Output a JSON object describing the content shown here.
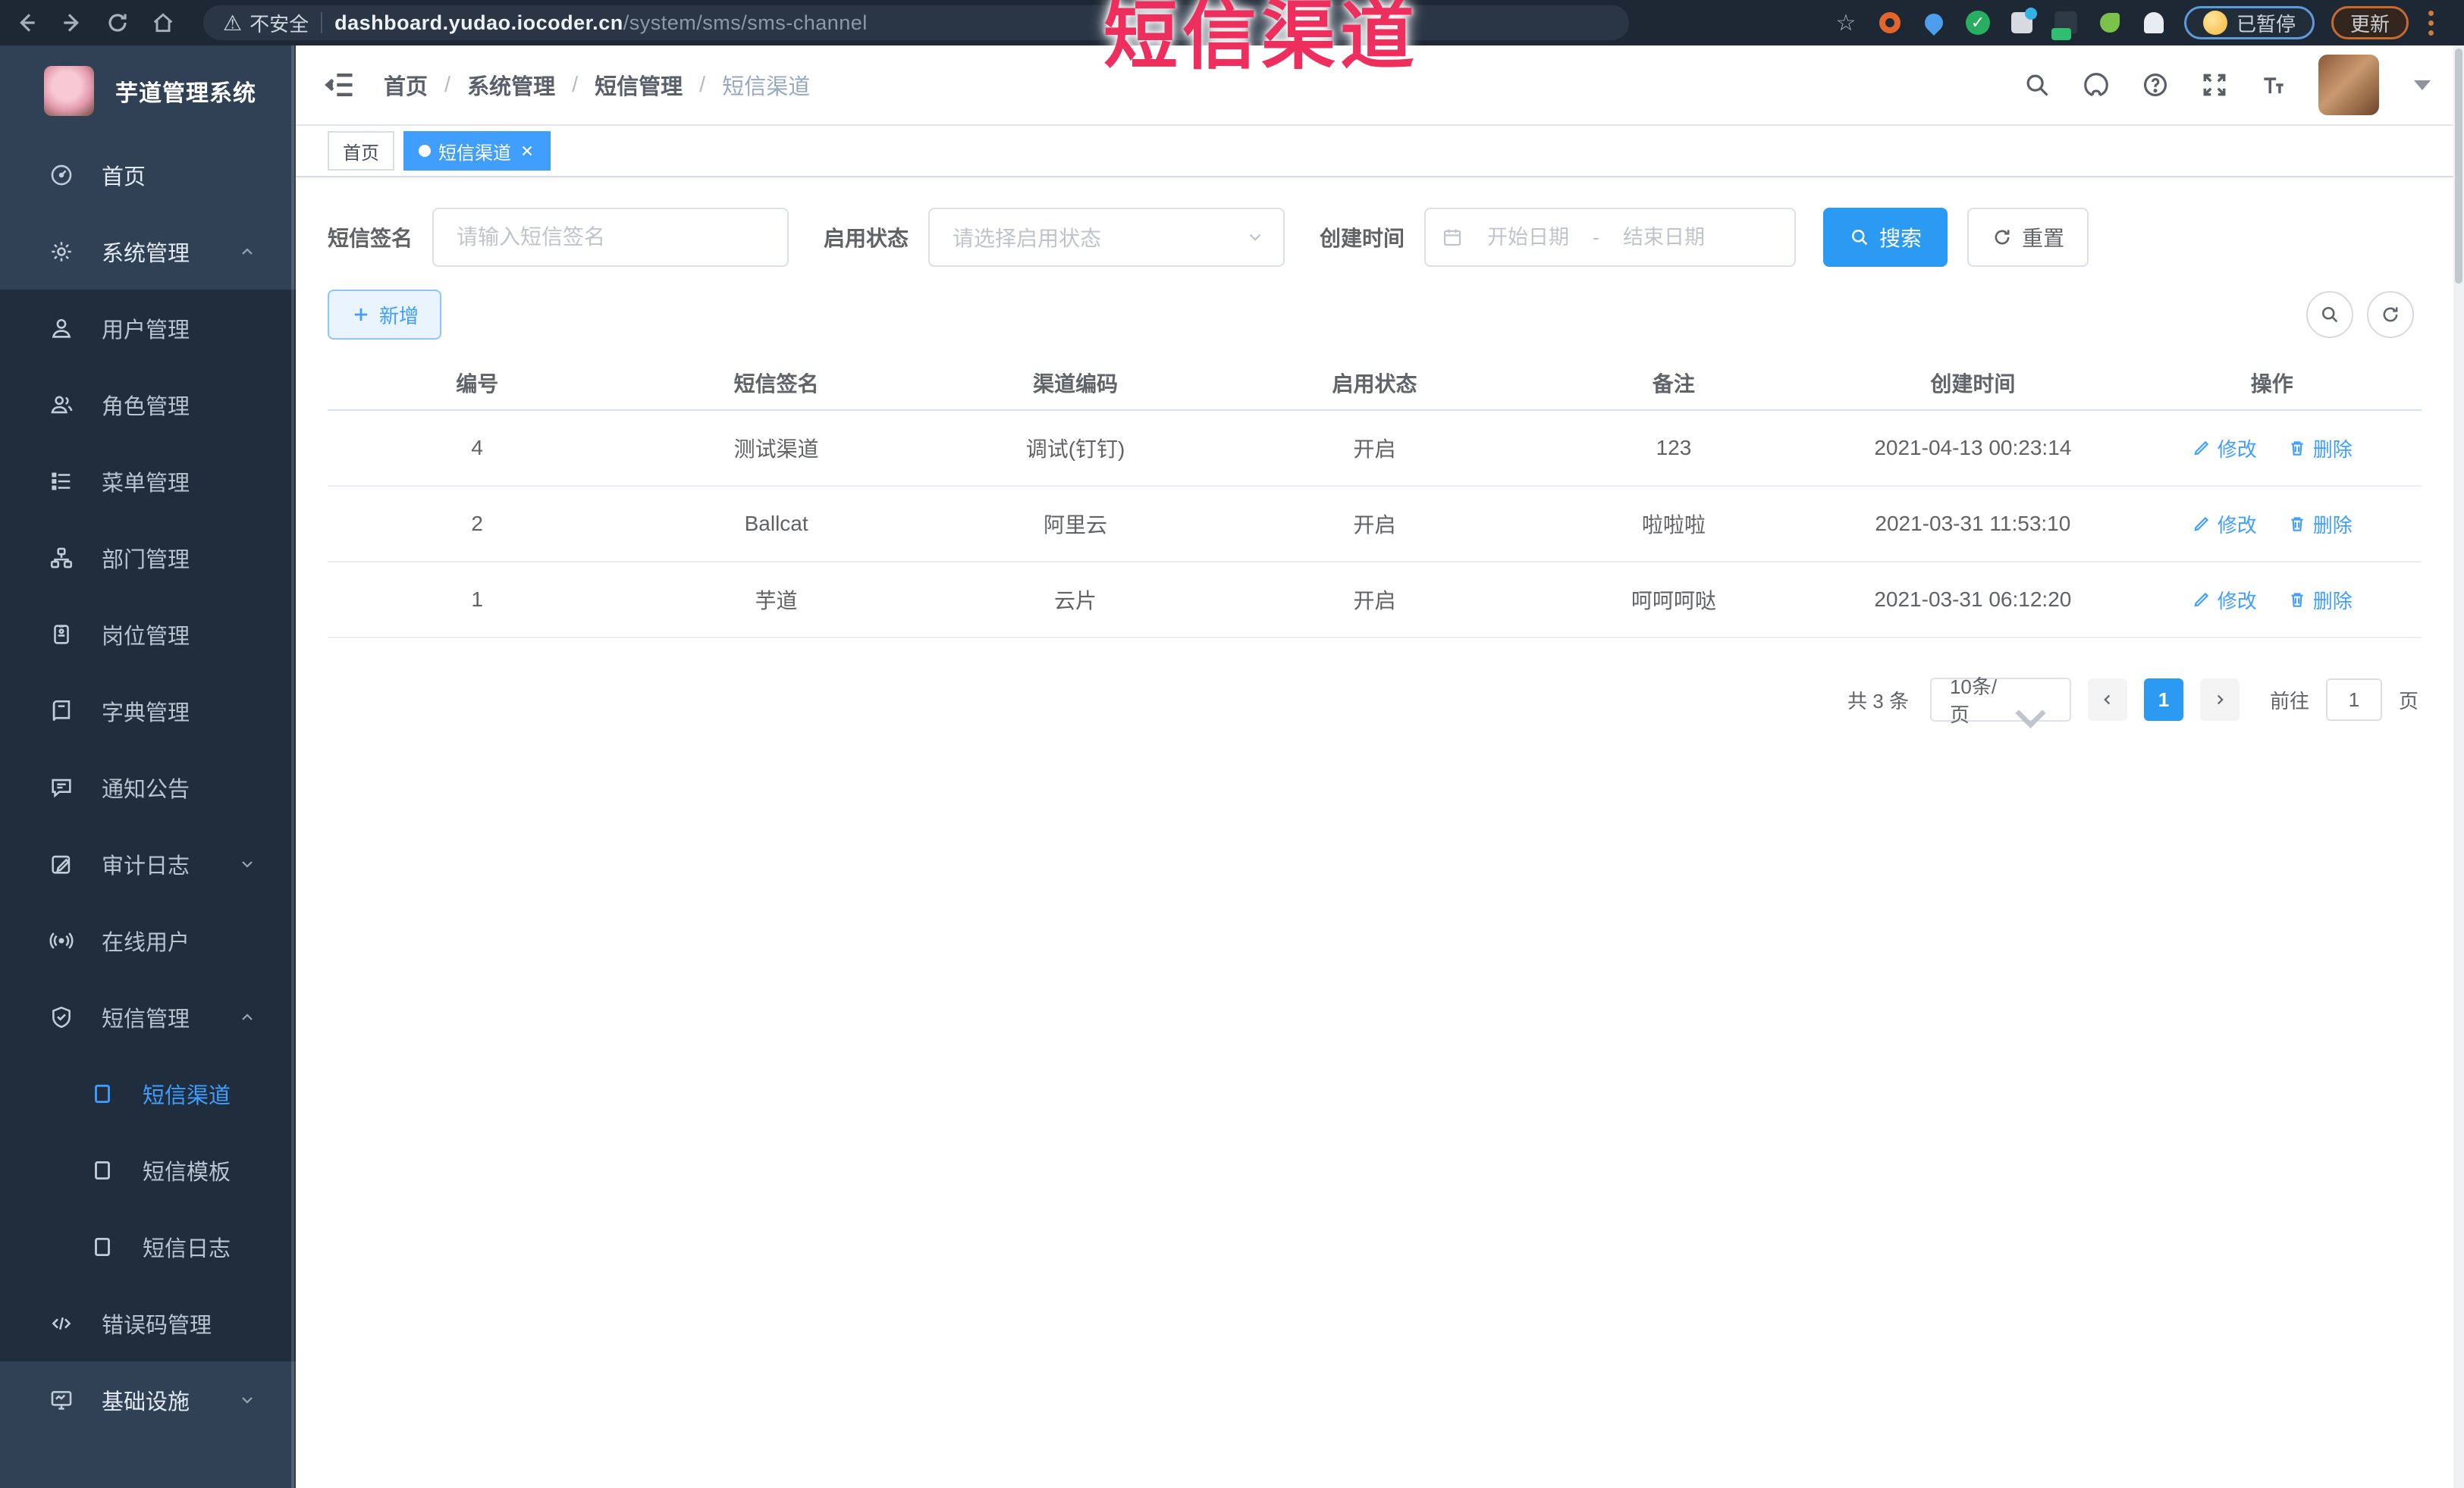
{
  "overlay": {
    "title": "短信渠道"
  },
  "colors": {
    "accent": "#409eff",
    "sidebar_bg": "#304156",
    "submenu_bg": "#1f2d3d",
    "overlay_red": "#ee2f5e",
    "tag_active": "#409eff",
    "search_btn": "#2b9af3"
  },
  "browser": {
    "security_label": "不安全",
    "url_host": "dashboard.yudao.iocoder.cn",
    "url_path": "/system/sms/sms-channel",
    "paused_label": "已暂停",
    "update_label": "更新"
  },
  "sidebar": {
    "app_title": "芋道管理系统",
    "items": [
      {
        "label": "首页"
      },
      {
        "label": "系统管理"
      },
      {
        "label": "用户管理"
      },
      {
        "label": "角色管理"
      },
      {
        "label": "菜单管理"
      },
      {
        "label": "部门管理"
      },
      {
        "label": "岗位管理"
      },
      {
        "label": "字典管理"
      },
      {
        "label": "通知公告"
      },
      {
        "label": "审计日志"
      },
      {
        "label": "在线用户"
      },
      {
        "label": "短信管理"
      },
      {
        "label": "短信渠道",
        "active": true
      },
      {
        "label": "短信模板"
      },
      {
        "label": "短信日志"
      },
      {
        "label": "错误码管理"
      },
      {
        "label": "基础设施"
      }
    ]
  },
  "header": {
    "breadcrumb": [
      "首页",
      "系统管理",
      "短信管理",
      "短信渠道"
    ],
    "separator": "/"
  },
  "tags": {
    "home": "首页",
    "active": "短信渠道"
  },
  "filters": {
    "sign_label": "短信签名",
    "sign_placeholder": "请输入短信签名",
    "status_label": "启用状态",
    "status_placeholder": "请选择启用状态",
    "time_label": "创建时间",
    "start_placeholder": "开始日期",
    "range_separator": "-",
    "end_placeholder": "结束日期",
    "search_label": "搜索",
    "reset_label": "重置"
  },
  "toolbar": {
    "add_label": "新增"
  },
  "table": {
    "headers": [
      "编号",
      "短信签名",
      "渠道编码",
      "启用状态",
      "备注",
      "创建时间",
      "操作"
    ],
    "edit_label": "修改",
    "delete_label": "删除",
    "rows": [
      {
        "id": "4",
        "sign": "测试渠道",
        "code": "调试(钉钉)",
        "status": "开启",
        "remark": "123",
        "created": "2021-04-13 00:23:14"
      },
      {
        "id": "2",
        "sign": "Ballcat",
        "code": "阿里云",
        "status": "开启",
        "remark": "啦啦啦",
        "created": "2021-03-31 11:53:10"
      },
      {
        "id": "1",
        "sign": "芋道",
        "code": "云片",
        "status": "开启",
        "remark": "呵呵呵哒",
        "created": "2021-03-31 06:12:20"
      }
    ]
  },
  "pagination": {
    "total_label": "共 3 条",
    "page_size_label": "10条/页",
    "current_page": "1",
    "goto_label": "前往",
    "goto_value": "1",
    "page_unit_label": "页"
  }
}
